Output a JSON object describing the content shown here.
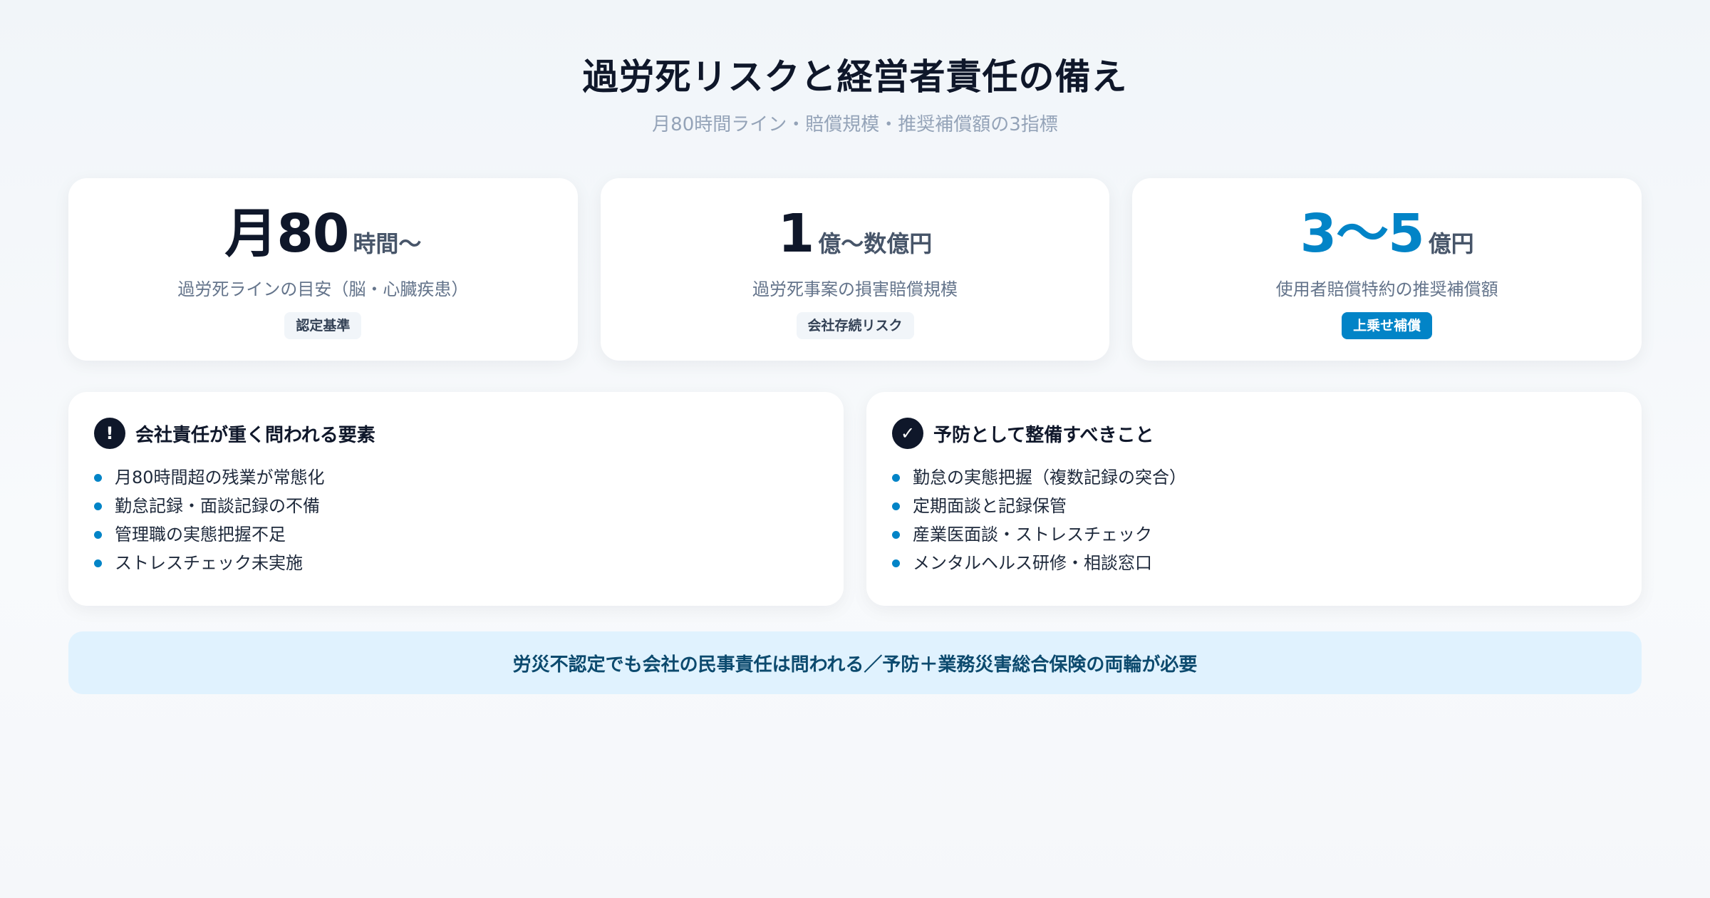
{
  "header": {
    "title": "過労死リスクと経営者責任の備え",
    "subtitle": "月80時間ライン・賠償規模・推奨補償額の3指標"
  },
  "stats": [
    {
      "value": "月80",
      "unit": "時間〜",
      "label": "過労死ラインの目安（脳・心臓疾患）",
      "tag": "認定基準"
    },
    {
      "value": "1",
      "unit": "億〜数億円",
      "label": "過労死事案の損害賠償規模",
      "tag": "会社存続リスク"
    },
    {
      "value": "3〜5",
      "unit": "億円",
      "label": "使用者賠償特約の推奨補償額",
      "tag": "上乗せ補償"
    }
  ],
  "panels": {
    "risk": {
      "icon": "!",
      "icon_name": "exclamation-icon",
      "title": "会社責任が重く問われる要素",
      "items": [
        "月80時間超の残業が常態化",
        "勤怠記録・面談記録の不備",
        "管理職の実態把握不足",
        "ストレスチェック未実施"
      ]
    },
    "prevention": {
      "icon": "✓",
      "icon_name": "check-icon",
      "title": "予防として整備すべきこと",
      "items": [
        "勤怠の実態把握（複数記録の突合）",
        "定期面談と記録保管",
        "産業医面談・ストレスチェック",
        "メンタルヘルス研修・相談窓口"
      ]
    }
  },
  "footer": {
    "text": "労災不認定でも会社の民事責任は問われる／予防＋業務災害総合保険の両輪が必要"
  },
  "colors": {
    "accent": "#0284c7",
    "dark": "#0f172a",
    "banner_bg": "#e0f2fe",
    "banner_text": "#0c4a6e"
  }
}
